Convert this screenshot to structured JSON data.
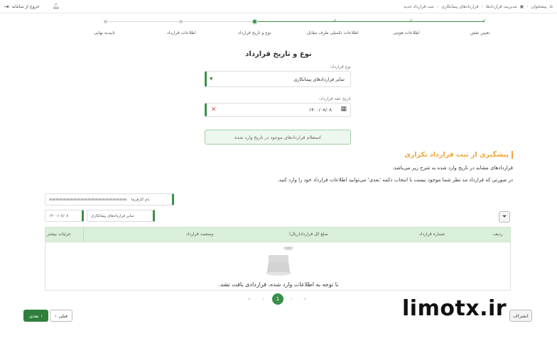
{
  "topbar": {
    "breadcrumb": [
      "پیشخوان",
      "مدیریت قراردادها",
      "قراردادهای پیمانکاری",
      "ثبت قرارداد جدید"
    ],
    "exit_label": "خروج از سامانه"
  },
  "steps": [
    {
      "label": "تعیین نقش",
      "state": "done"
    },
    {
      "label": "اطلاعات هویتی",
      "state": "done"
    },
    {
      "label": "اطلاعات تکمیلی طرف مقابل",
      "state": "done"
    },
    {
      "label": "نوع و تاریخ قرارداد",
      "state": "current"
    },
    {
      "label": "اطلاعات قرارداد",
      "state": "todo"
    },
    {
      "label": "تاییدیه نهایی",
      "state": "todo"
    }
  ],
  "form": {
    "title": "نوع و تاریخ قرارداد",
    "type_label": "نوع قرارداد:",
    "type_value": "سایر قراردادهای پیمانکاری",
    "date_label": "تاریخ عقد قرارداد:",
    "date_value": "۱۴۰۰/۰۸/۰۸",
    "lookup_button": "استعلام قراردادهای موجود در تاریخ وارد شده"
  },
  "warning": {
    "title": "پیشگیری از ثبت قرارداد تکراری",
    "line1": "قراردادهای مشابه در تاریخ وارد شده به شرح زیر می‌باشد.",
    "line2": "در صورتی که قرارداد مد نظر شما موجود نیست با انتخاب دکمه 'بعدی' می‌توانید اطلاعات قرارداد خود را وارد کنید."
  },
  "filters": {
    "employer_label": "نام کارفرما",
    "type_value": "سایر قراردادهای پیمانکاری",
    "date_value": "۱۴۰۰/۰۸/۰۸"
  },
  "table": {
    "headers": [
      "ردیف",
      "شماره قرارداد",
      "مبلغ کل قرارداد(ریال)",
      "وضعیت قرارداد",
      "جزئیات بیشتر"
    ],
    "empty_text": "با توجه به اطلاعات وارد شده، قراردادی یافت نشد."
  },
  "pagination": {
    "current": "1"
  },
  "buttons": {
    "next": "بعدی",
    "prev": "قبلی",
    "cancel": "انصراف"
  },
  "watermark": "limotx.ir",
  "colors": {
    "accent": "#3a8f4a",
    "warning": "#f0a331",
    "header_bg": "#d9efd9"
  }
}
